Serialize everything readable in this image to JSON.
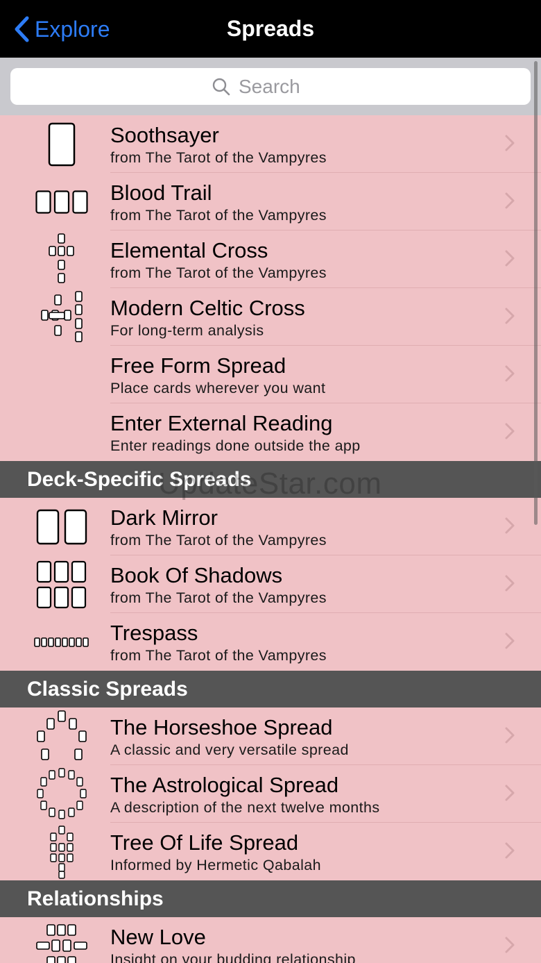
{
  "nav": {
    "back_label": "Explore",
    "title": "Spreads"
  },
  "search": {
    "placeholder": "Search"
  },
  "watermark": "UpdateStar.com",
  "rows": [
    {
      "title": "Soothsayer",
      "subtitle": "from The Tarot of the Vampyres"
    },
    {
      "title": "Blood Trail",
      "subtitle": "from The Tarot of the Vampyres"
    },
    {
      "title": "Elemental Cross",
      "subtitle": "from The Tarot of the Vampyres"
    },
    {
      "title": "Modern Celtic Cross",
      "subtitle": "For long-term analysis"
    },
    {
      "title": "Free Form Spread",
      "subtitle": "Place cards wherever you want"
    },
    {
      "title": "Enter External Reading",
      "subtitle": "Enter readings done outside the app"
    }
  ],
  "sections": [
    {
      "title": "Deck-Specific Spreads",
      "rows": [
        {
          "title": "Dark Mirror",
          "subtitle": "from The Tarot of the Vampyres"
        },
        {
          "title": "Book Of Shadows",
          "subtitle": "from The Tarot of the Vampyres"
        },
        {
          "title": "Trespass",
          "subtitle": "from The Tarot of the Vampyres"
        }
      ]
    },
    {
      "title": "Classic Spreads",
      "rows": [
        {
          "title": "The Horseshoe Spread",
          "subtitle": "A classic and very versatile spread"
        },
        {
          "title": "The Astrological Spread",
          "subtitle": "A description of the next twelve months"
        },
        {
          "title": "Tree Of Life Spread",
          "subtitle": "Informed by Hermetic Qabalah"
        }
      ]
    },
    {
      "title": "Relationships",
      "rows": [
        {
          "title": "New Love",
          "subtitle": "Insight on your budding relationship"
        }
      ]
    }
  ],
  "colors": {
    "accent": "#2d7cf6",
    "row_background": "#f0c2c6",
    "section_background": "#555555",
    "navbar_background": "#000000"
  }
}
